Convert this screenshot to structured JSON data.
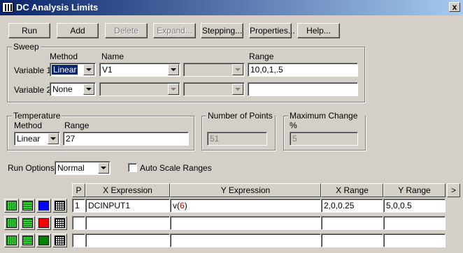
{
  "window": {
    "title": "DC Analysis Limits",
    "close_glyph": "x"
  },
  "toolbar": {
    "run": "Run",
    "add": "Add",
    "delete": "Delete",
    "expand": "Expand...",
    "stepping": "Stepping...",
    "properties": "Properties...",
    "help": "Help..."
  },
  "sweep": {
    "legend": "Sweep",
    "method_header": "Method",
    "name_header": "Name",
    "range_header": "Range",
    "variable1": {
      "label": "Variable 1",
      "method": "Linear",
      "name": "V1",
      "range": "10,0,1,.5"
    },
    "variable2": {
      "label": "Variable 2",
      "method": "None",
      "name": "",
      "range": ""
    }
  },
  "temperature": {
    "legend": "Temperature",
    "method_header": "Method",
    "range_header": "Range",
    "method": "Linear",
    "range": "27"
  },
  "points": {
    "legend": "Number of Points",
    "value": "51"
  },
  "maxchange": {
    "legend": "Maximum Change %",
    "value": "5"
  },
  "run_options": {
    "label": "Run Options",
    "value": "Normal"
  },
  "auto_scale": {
    "label": "Auto Scale Ranges",
    "checked": false
  },
  "grid": {
    "headers": {
      "p": "P",
      "x_expr": "X Expression",
      "y_expr": "Y Expression",
      "x_range": "X Range",
      "y_range": "Y Range",
      "more": ">"
    },
    "rows": [
      {
        "color": "#0000ff",
        "p": "1",
        "x_expr": "DCINPUT1",
        "y_expr_prefix": "v(",
        "y_expr_node": "6",
        "y_expr_suffix": ")",
        "x_range": "2,0,0.25",
        "y_range": "5,0,0.5"
      },
      {
        "color": "#ff0000",
        "p": "",
        "x_expr": "",
        "y_expr_prefix": "",
        "y_expr_node": "",
        "y_expr_suffix": "",
        "x_range": "",
        "y_range": ""
      },
      {
        "color": "#008000",
        "p": "",
        "x_expr": "",
        "y_expr_prefix": "",
        "y_expr_node": "",
        "y_expr_suffix": "",
        "x_range": "",
        "y_range": ""
      }
    ]
  },
  "colors": {
    "title_start": "#0a246a",
    "title_end": "#a6caf0",
    "face": "#d4d0c8",
    "node_highlight": "#c00000"
  }
}
